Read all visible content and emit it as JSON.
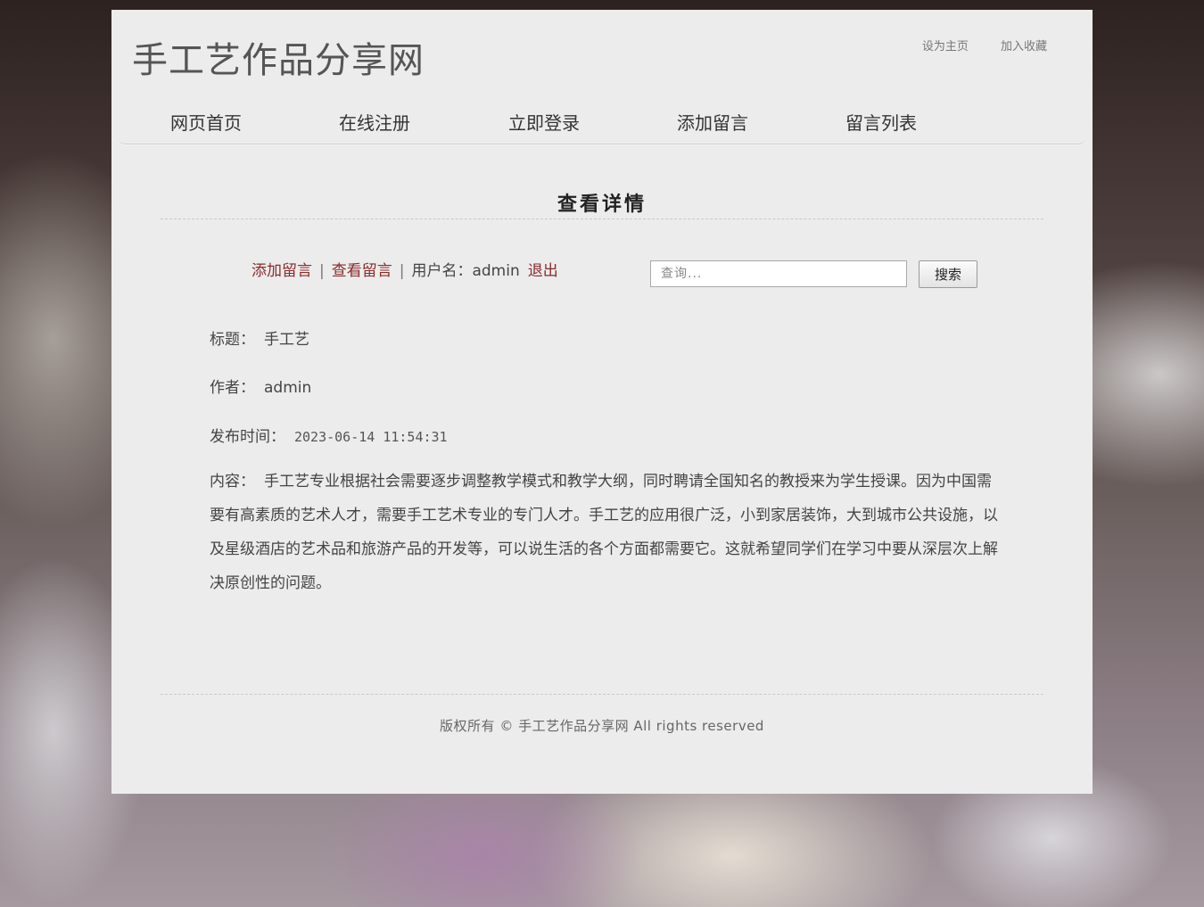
{
  "header": {
    "site_title": "手工艺作品分享网",
    "top_links": [
      "设为主页",
      "加入收藏"
    ]
  },
  "nav": {
    "items": [
      "网页首页",
      "在线注册",
      "立即登录",
      "添加留言",
      "留言列表"
    ]
  },
  "main": {
    "heading": "查看详情",
    "actions": {
      "add_message": "添加留言",
      "view_messages": "查看留言",
      "separator": "|",
      "username_label": "用户名：admin",
      "logout": "退出"
    },
    "search": {
      "placeholder": "查询...",
      "button_label": "搜索"
    },
    "details": {
      "title_label": "标题：",
      "title_value": "手工艺",
      "author_label": "作者：",
      "author_value": "admin",
      "time_label": "发布时间：",
      "time_value": "2023-06-14 11:54:31",
      "content_label": "内容：",
      "content_value": "手工艺专业根据社会需要逐步调整教学模式和教学大纲，同时聘请全国知名的教授来为学生授课。因为中国需要有高素质的艺术人才，需要手工艺术专业的专门人才。手工艺的应用很广泛，小到家居装饰，大到城市公共设施，以及星级酒店的艺术品和旅游产品的开发等，可以说生活的各个方面都需要它。这就希望同学们在学习中要从深层次上解决原创性的问题。"
    }
  },
  "footer": {
    "copyright": "版权所有 © 手工艺作品分享网 All rights reserved"
  },
  "colors": {
    "panel": "#ececec",
    "link": "#8b2b2b",
    "text": "#444444"
  }
}
